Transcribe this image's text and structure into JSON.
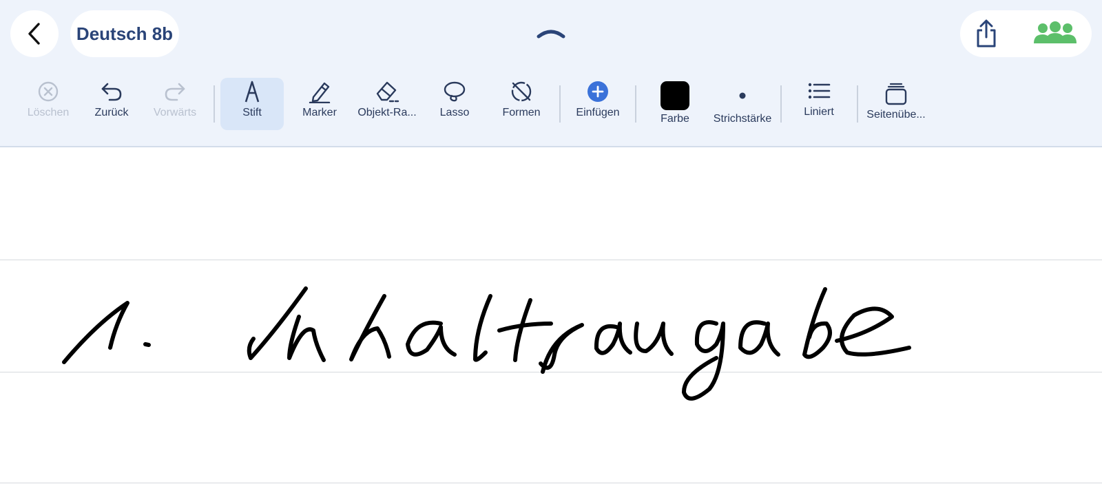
{
  "header": {
    "title": "Deutsch 8b"
  },
  "toolbar": {
    "tools": [
      {
        "id": "delete",
        "label": "Löschen",
        "icon": "close-circle-icon",
        "enabled": false
      },
      {
        "id": "undo",
        "label": "Zurück",
        "icon": "undo-icon",
        "enabled": true
      },
      {
        "id": "redo",
        "label": "Vorwärts",
        "icon": "redo-icon",
        "enabled": false
      },
      {
        "id": "pen",
        "label": "Stift",
        "icon": "pen-icon",
        "enabled": true,
        "selected": true
      },
      {
        "id": "marker",
        "label": "Marker",
        "icon": "marker-icon",
        "enabled": true
      },
      {
        "id": "eraser",
        "label": "Objekt-Ra...",
        "icon": "eraser-icon",
        "enabled": true
      },
      {
        "id": "lasso",
        "label": "Lasso",
        "icon": "lasso-icon",
        "enabled": true
      },
      {
        "id": "shapes",
        "label": "Formen",
        "icon": "shapes-off-icon",
        "enabled": true
      },
      {
        "id": "insert",
        "label": "Einfügen",
        "icon": "plus-circle-icon",
        "enabled": true
      },
      {
        "id": "color",
        "label": "Farbe",
        "icon": "color-swatch",
        "enabled": true
      },
      {
        "id": "stroke",
        "label": "Strichstärke",
        "icon": "dot-icon",
        "enabled": true
      },
      {
        "id": "ruled",
        "label": "Liniert",
        "icon": "list-icon",
        "enabled": true
      },
      {
        "id": "pages",
        "label": "Seitenübe...",
        "icon": "pages-icon",
        "enabled": true
      }
    ]
  },
  "colors": {
    "accent": "#2a4478",
    "toolbar_bg": "#eef3fb",
    "selected_tool_bg": "#d9e6f8",
    "insert_blue": "#3b72d9",
    "collab_green": "#5cbf6a",
    "current_ink_color": "#000000"
  },
  "canvas": {
    "handwriting": "1. Inhaltsangabe"
  }
}
